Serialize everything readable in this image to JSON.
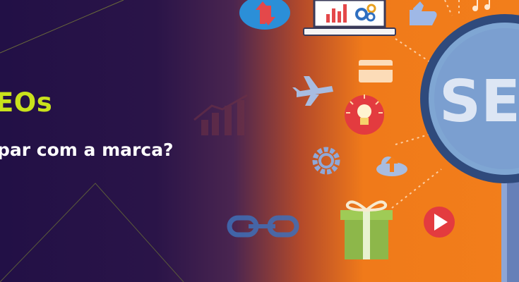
{
  "banner": {
    "title_line_1": "EOs",
    "title_line_2": "par com a marca?",
    "magnifier_text": "SEO",
    "colors": {
      "background_dark": "#221046",
      "background_orange": "#f27e1b",
      "accent_green": "#c9e21c",
      "magnifier_blue": "#7fa6d3"
    }
  },
  "icons": [
    "cloud-sync-icon",
    "monitor-chart-icon",
    "gears-icon",
    "thumbs-up-icon",
    "music-notes-icon",
    "credit-card-icon",
    "airplane-icon",
    "lightbulb-icon",
    "growth-chart-icon",
    "gear-icon",
    "cloud-upload-icon",
    "gift-icon",
    "play-button-icon",
    "link-icon",
    "magnifying-glass-icon"
  ]
}
